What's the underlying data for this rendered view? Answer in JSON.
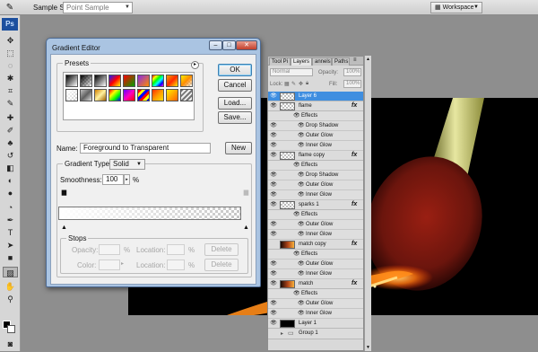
{
  "options_bar": {
    "tool_icon": "eyedropper-icon",
    "sample_size_label": "Sample Size:",
    "sample_size_value": "Point Sample",
    "workspace_label": "Workspace"
  },
  "toolbox": {
    "logo": "Ps",
    "tools": [
      "move-icon",
      "marquee-icon",
      "lasso-icon",
      "quick-select-icon",
      "crop-icon",
      "eyedropper-icon",
      "healing-icon",
      "brush-icon",
      "clone-stamp-icon",
      "history-brush-icon",
      "eraser-icon",
      "gradient-icon",
      "blur-icon",
      "dodge-icon",
      "pen-icon",
      "type-icon",
      "path-select-icon",
      "shape-icon",
      "hand-icon",
      "zoom-icon"
    ]
  },
  "gradient_editor": {
    "title": "Gradient Editor",
    "presets_label": "Presets",
    "buttons": {
      "ok": "OK",
      "cancel": "Cancel",
      "load": "Load...",
      "save": "Save...",
      "new": "New"
    },
    "name_label": "Name:",
    "name_value": "Foreground to Transparent",
    "gradient_type_label": "Gradient Type:",
    "gradient_type_value": "Solid",
    "smoothness_label": "Smoothness:",
    "smoothness_value": "100",
    "smoothness_unit": "%",
    "stops": {
      "title": "Stops",
      "opacity_label": "Opacity:",
      "color_label": "Color:",
      "percent": "%",
      "location_label": "Location:",
      "delete_label": "Delete"
    }
  },
  "layers_panel": {
    "tabs": [
      "Tool Pi",
      "Layers",
      "annels",
      "Paths"
    ],
    "blend_mode": "Normal",
    "opacity_label": "Opacity:",
    "opacity_value": "100%",
    "lock_label": "Lock:",
    "fill_label": "Fill:",
    "fill_value": "100%",
    "rows": [
      {
        "kind": "layer",
        "name": "Layer 6",
        "selected": true,
        "visible": true,
        "fx": false,
        "thumb": "checker"
      },
      {
        "kind": "layer",
        "name": "flame",
        "visible": true,
        "fx": true,
        "thumb": "checker"
      },
      {
        "kind": "group-effects",
        "name": "Effects"
      },
      {
        "kind": "effect",
        "name": "Drop Shadow"
      },
      {
        "kind": "effect",
        "name": "Outer Glow"
      },
      {
        "kind": "effect",
        "name": "Inner Glow"
      },
      {
        "kind": "layer",
        "name": "flame copy",
        "visible": true,
        "fx": true,
        "thumb": "checker"
      },
      {
        "kind": "group-effects",
        "name": "Effects"
      },
      {
        "kind": "effect",
        "name": "Drop Shadow"
      },
      {
        "kind": "effect",
        "name": "Outer Glow"
      },
      {
        "kind": "effect",
        "name": "Inner Glow"
      },
      {
        "kind": "layer",
        "name": "sparks 1",
        "visible": true,
        "fx": true,
        "thumb": "checker"
      },
      {
        "kind": "group-effects",
        "name": "Effects"
      },
      {
        "kind": "effect",
        "name": "Outer Glow"
      },
      {
        "kind": "effect",
        "name": "Inner Glow"
      },
      {
        "kind": "layer",
        "name": "match copy",
        "visible": false,
        "fx": true,
        "thumb": "match"
      },
      {
        "kind": "group-effects",
        "name": "Effects"
      },
      {
        "kind": "effect",
        "name": "Outer Glow"
      },
      {
        "kind": "effect",
        "name": "Inner Glow"
      },
      {
        "kind": "layer",
        "name": "match",
        "visible": true,
        "fx": true,
        "thumb": "match"
      },
      {
        "kind": "group-effects",
        "name": "Effects"
      },
      {
        "kind": "effect",
        "name": "Outer Glow"
      },
      {
        "kind": "effect",
        "name": "Inner Glow"
      },
      {
        "kind": "layer",
        "name": "Layer 1",
        "visible": true,
        "fx": false,
        "thumb": "black"
      },
      {
        "kind": "folder",
        "name": "Group 1",
        "visible": false
      }
    ]
  },
  "colors": {
    "accent_selected": "#3f8ee0",
    "dialog_frame": "#aac4e2",
    "canvas_bg": "#000000"
  }
}
